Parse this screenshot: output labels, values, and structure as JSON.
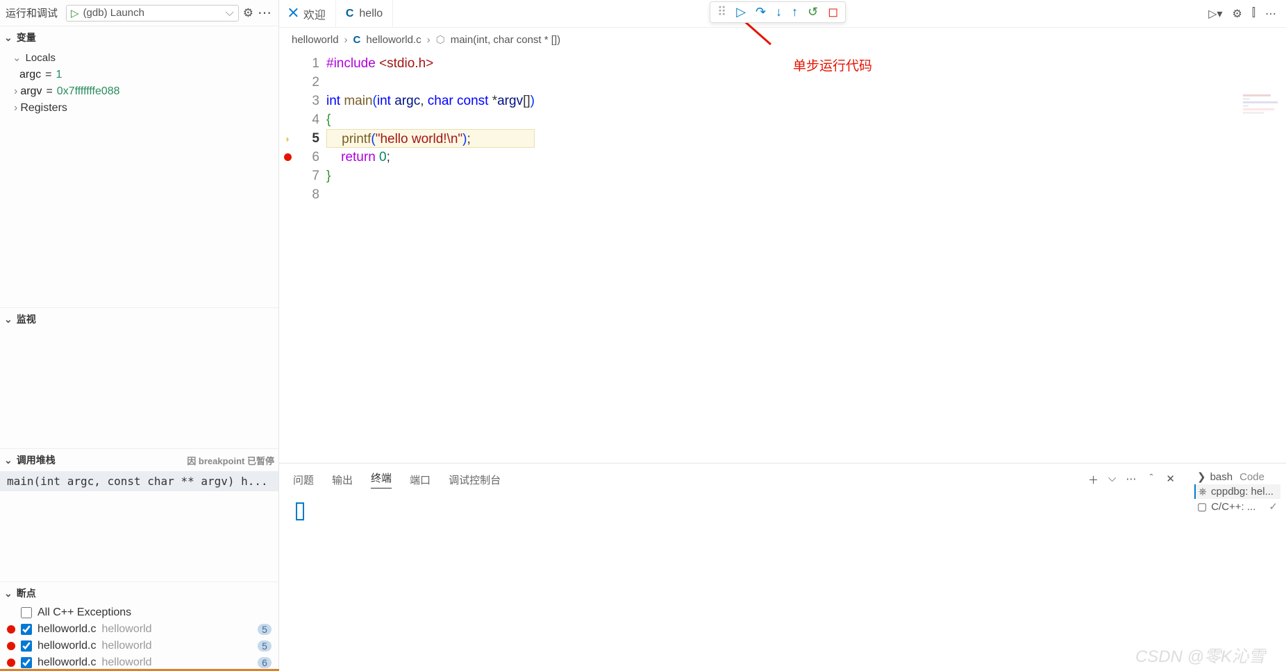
{
  "sidebar": {
    "title": "运行和调试",
    "config_name": "(gdb) Launch",
    "sections": {
      "variables": "变量",
      "locals": "Locals",
      "watch": "监视",
      "callstack": "调用堆栈",
      "breakpoints": "断点",
      "registers": "Registers"
    },
    "vars": {
      "argc_name": "argc",
      "argc_val": "1",
      "argv_name": "argv",
      "argv_val": "0x7fffffffe088"
    },
    "callstack_status": "因 breakpoint 已暂停",
    "callstack_frame": "main(int argc, const char ** argv)  h...",
    "bp": {
      "all_exc": "All C++ Exceptions",
      "items": [
        {
          "file": "helloworld.c",
          "path": "helloworld",
          "line": "5"
        },
        {
          "file": "helloworld.c",
          "path": "helloworld",
          "line": "5"
        },
        {
          "file": "helloworld.c",
          "path": "helloworld",
          "line": "6"
        }
      ]
    }
  },
  "tabs": {
    "welcome": "欢迎",
    "file": "hello"
  },
  "breadcrumb": {
    "folder": "helloworld",
    "file": "helloworld.c",
    "symbol": "main(int, char const * [])"
  },
  "annotation": "单步运行代码",
  "panel": {
    "tabs": {
      "problems": "问题",
      "output": "输出",
      "terminal": "终端",
      "ports": "端口",
      "debug": "调试控制台"
    },
    "terminals": {
      "bash": "bash",
      "bash_badge": "Code",
      "cppdbg": "cppdbg: hel...",
      "cpp": "C/C++: ..."
    }
  },
  "code": {
    "eq": " = "
  },
  "watermark": "CSDN @零K沁雪"
}
